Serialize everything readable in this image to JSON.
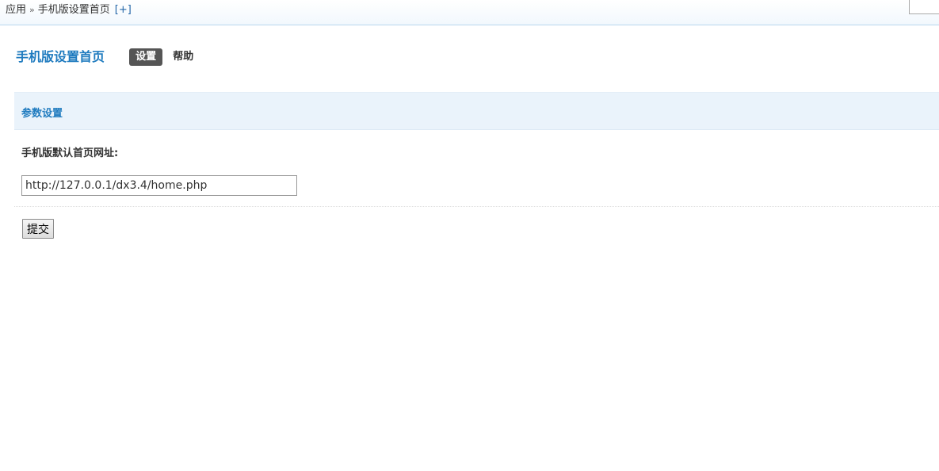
{
  "breadcrumb": {
    "root": "应用",
    "separator": "»",
    "current": "手机版设置首页",
    "add_link": "[+]"
  },
  "header": {
    "title": "手机版设置首页",
    "tabs": [
      {
        "label": "设置",
        "active": true
      },
      {
        "label": "帮助",
        "active": false
      }
    ]
  },
  "section": {
    "title": "参数设置"
  },
  "form": {
    "field_label": "手机版默认首页网址:",
    "url_value": "http://127.0.0.1/dx3.4/home.php",
    "submit_label": "提交"
  },
  "colors": {
    "accent": "#1f7bbf",
    "active_tab_bg": "#555555",
    "section_bg": "#eaf3fb"
  }
}
